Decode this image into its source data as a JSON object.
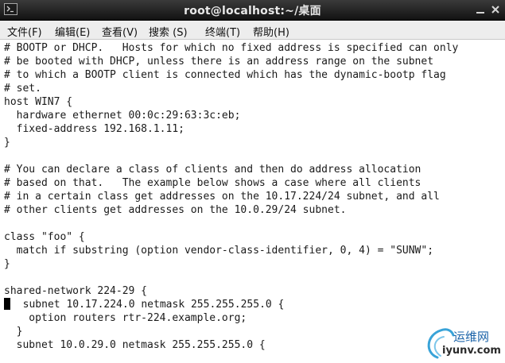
{
  "window": {
    "title": "root@localhost:~/桌面"
  },
  "menu": {
    "items": [
      "文件(F)",
      "编辑(E)",
      "查看(V)",
      "搜索 (S)",
      "终端(T)",
      "帮助(H)"
    ]
  },
  "terminal": {
    "lines": [
      "# BOOTP or DHCP.   Hosts for which no fixed address is specified can only",
      "# be booted with DHCP, unless there is an address range on the subnet",
      "# to which a BOOTP client is connected which has the dynamic-bootp flag",
      "# set.",
      "host WIN7 {",
      "  hardware ethernet 00:0c:29:63:3c:eb;",
      "  fixed-address 192.168.1.11;",
      "}",
      "",
      "# You can declare a class of clients and then do address allocation",
      "# based on that.   The example below shows a case where all clients",
      "# in a certain class get addresses on the 10.17.224/24 subnet, and all",
      "# other clients get addresses on the 10.0.29/24 subnet.",
      "",
      "class \"foo\" {",
      "  match if substring (option vendor-class-identifier, 0, 4) = \"SUNW\";",
      "}",
      "",
      "shared-network 224-29 {",
      "  subnet 10.17.224.0 netmask 255.255.255.0 {",
      "    option routers rtr-224.example.org;",
      "  }",
      "  subnet 10.0.29.0 netmask 255.255.255.0 {"
    ],
    "cursor_line_index": 19
  },
  "watermark": {
    "site_cn": "运维网",
    "site_en": "iyunv.com"
  },
  "colors": {
    "titlebar": "#1e1e1e",
    "menubar": "#ededed",
    "terminal_bg": "#ffffff",
    "terminal_fg": "#1a1a1a",
    "watermark_blue": "#1b63a8"
  },
  "icons": {
    "app": "terminal-icon",
    "minimize": "minimize-icon",
    "close": "close-icon"
  }
}
